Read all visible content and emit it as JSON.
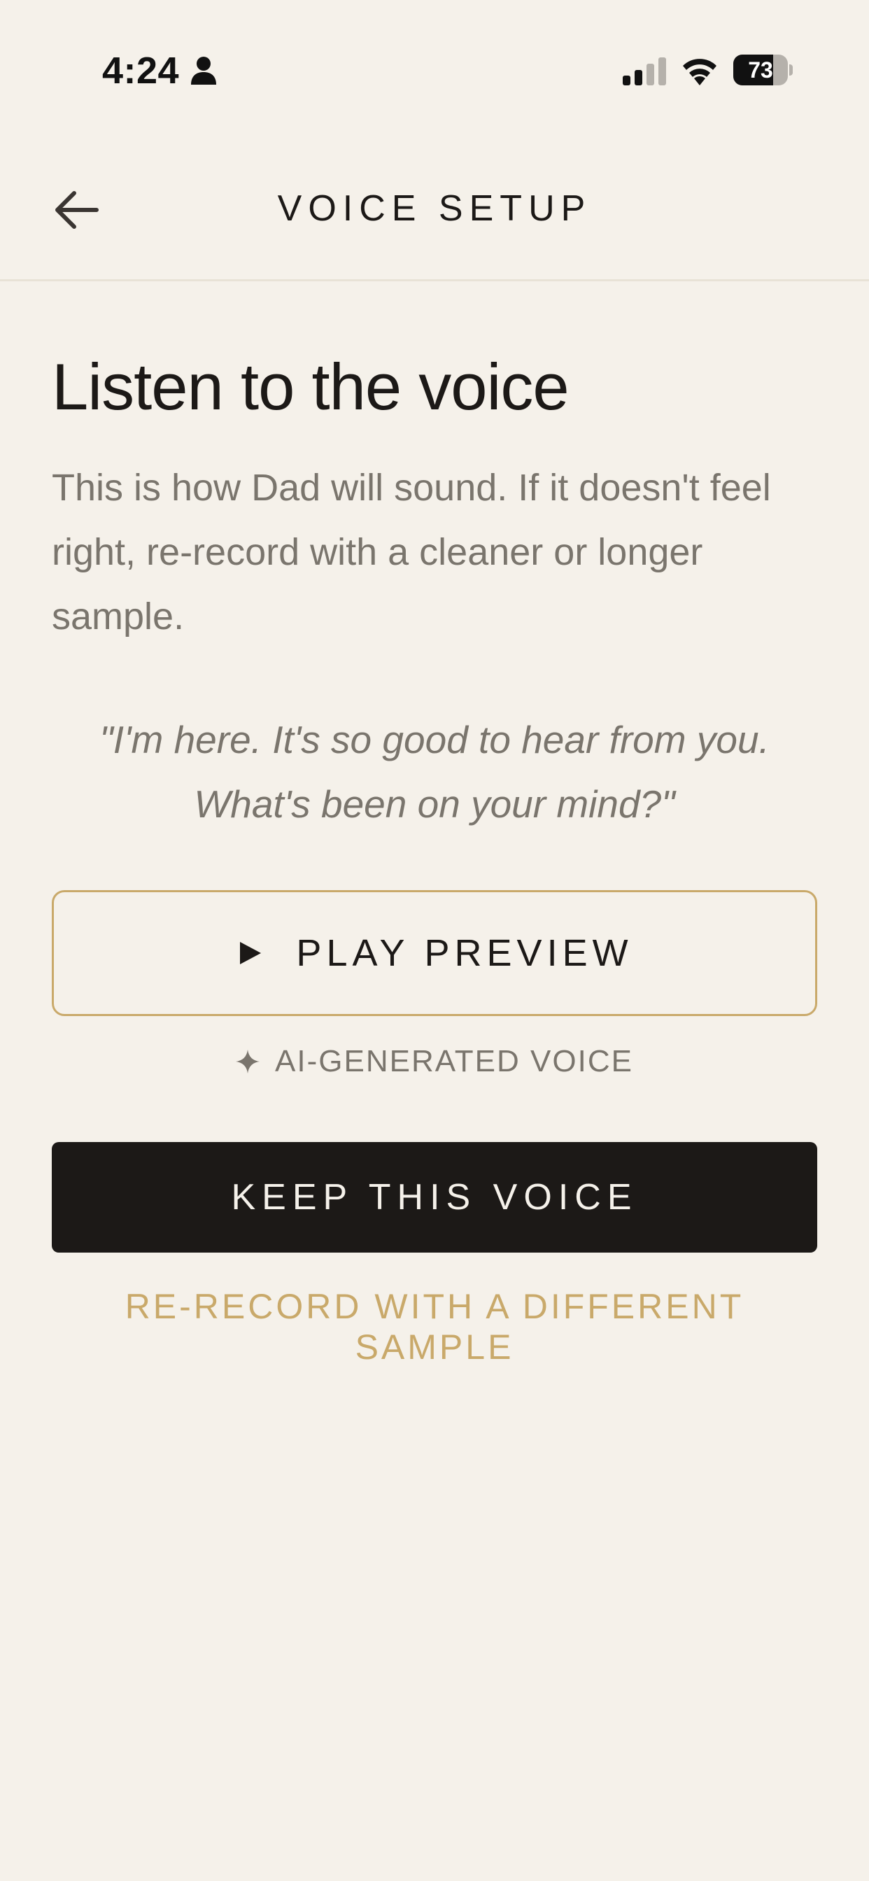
{
  "status_bar": {
    "time": "4:24",
    "battery_level": "73",
    "battery_fraction": 0.73
  },
  "nav": {
    "title": "VOICE SETUP",
    "back_icon": "arrow-left-icon"
  },
  "main": {
    "heading": "Listen to the voice",
    "description": "This is how Dad will sound. If it doesn't feel right, re-record with a cleaner or longer sample.",
    "quote": "\"I'm here. It's so good to hear from you. What's been on your mind?\"",
    "play_button_label": "PLAY PREVIEW",
    "ai_badge_label": "AI-GENERATED VOICE",
    "keep_button_label": "KEEP THIS VOICE",
    "rerecord_label": "RE-RECORD WITH A DIFFERENT SAMPLE"
  },
  "colors": {
    "background": "#f5f1ea",
    "primary_text": "#1c1917",
    "secondary_text": "#7a756d",
    "accent_gold": "#c9a96a",
    "button_dark": "#1c1917"
  }
}
